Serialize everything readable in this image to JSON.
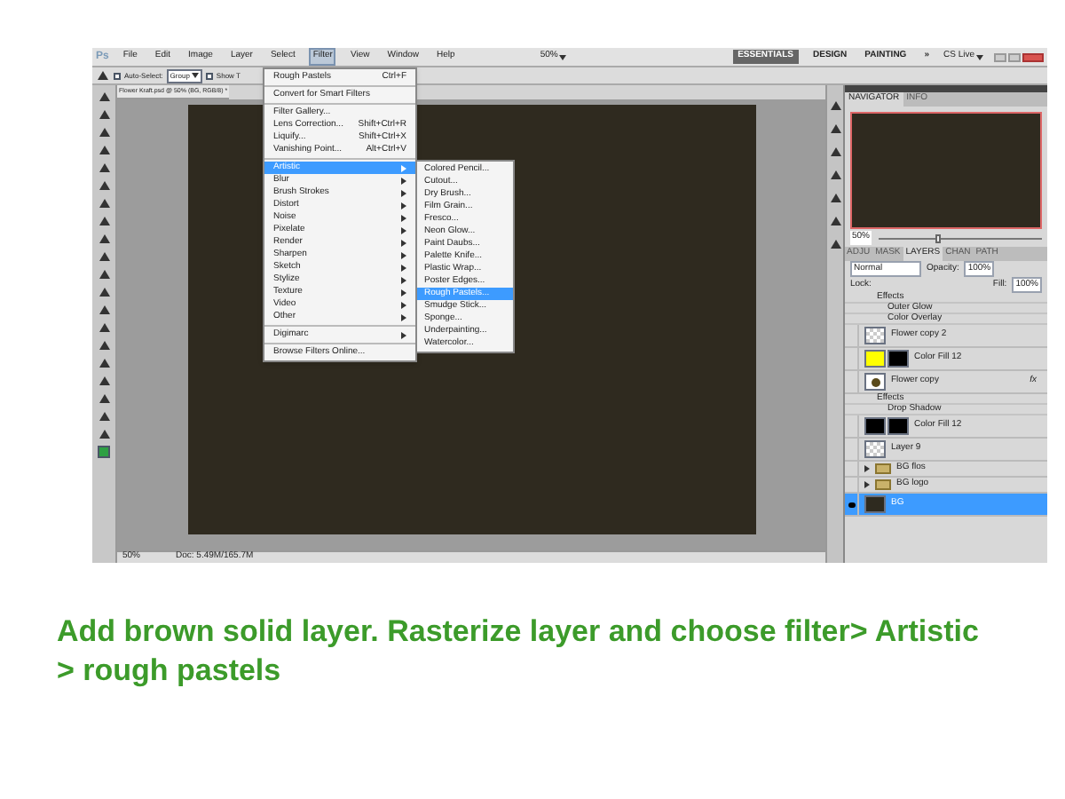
{
  "app_logo": "Ps",
  "menubar": [
    {
      "label": "File",
      "selected": false
    },
    {
      "label": "Edit",
      "selected": false
    },
    {
      "label": "Image",
      "selected": false
    },
    {
      "label": "Layer",
      "selected": false
    },
    {
      "label": "Select",
      "selected": false
    },
    {
      "label": "Filter",
      "selected": true
    },
    {
      "label": "View",
      "selected": false
    },
    {
      "label": "Window",
      "selected": false
    },
    {
      "label": "Help",
      "selected": false
    }
  ],
  "zoom": "50%",
  "workspaces": [
    {
      "label": "ESSENTIALS",
      "selected": true
    },
    {
      "label": "DESIGN",
      "selected": false
    },
    {
      "label": "PAINTING",
      "selected": false
    },
    {
      "label": "»",
      "selected": false
    }
  ],
  "cs_live": "CS Live",
  "options_bar": {
    "auto_select_checked": false,
    "auto_select_label": "Auto-Select:",
    "auto_select_value": "Group",
    "show_checked": false,
    "show_label": "Show T"
  },
  "document_tab": "Flower Kraft.psd @ 50% (BG, RGB/8) *",
  "filter_menu": [
    {
      "label": "Rough Pastels",
      "shortcut": "Ctrl+F",
      "submenu": false,
      "selected": false,
      "separator_after": true
    },
    {
      "label": "Convert for Smart Filters",
      "submenu": false,
      "selected": false,
      "separator_after": true
    },
    {
      "label": "Filter Gallery...",
      "submenu": false,
      "selected": false,
      "separator_after": false
    },
    {
      "label": "Lens Correction...",
      "shortcut": "Shift+Ctrl+R",
      "submenu": false,
      "selected": false,
      "separator_after": false
    },
    {
      "label": "Liquify...",
      "shortcut": "Shift+Ctrl+X",
      "submenu": false,
      "selected": false,
      "separator_after": false
    },
    {
      "label": "Vanishing Point...",
      "shortcut": "Alt+Ctrl+V",
      "submenu": false,
      "selected": false,
      "separator_after": true
    },
    {
      "label": "Artistic",
      "submenu": true,
      "selected": true,
      "separator_after": false
    },
    {
      "label": "Blur",
      "submenu": true,
      "selected": false,
      "separator_after": false
    },
    {
      "label": "Brush Strokes",
      "submenu": true,
      "selected": false,
      "separator_after": false
    },
    {
      "label": "Distort",
      "submenu": true,
      "selected": false,
      "separator_after": false
    },
    {
      "label": "Noise",
      "submenu": true,
      "selected": false,
      "separator_after": false
    },
    {
      "label": "Pixelate",
      "submenu": true,
      "selected": false,
      "separator_after": false
    },
    {
      "label": "Render",
      "submenu": true,
      "selected": false,
      "separator_after": false
    },
    {
      "label": "Sharpen",
      "submenu": true,
      "selected": false,
      "separator_after": false
    },
    {
      "label": "Sketch",
      "submenu": true,
      "selected": false,
      "separator_after": false
    },
    {
      "label": "Stylize",
      "submenu": true,
      "selected": false,
      "separator_after": false
    },
    {
      "label": "Texture",
      "submenu": true,
      "selected": false,
      "separator_after": false
    },
    {
      "label": "Video",
      "submenu": true,
      "selected": false,
      "separator_after": false
    },
    {
      "label": "Other",
      "submenu": true,
      "selected": false,
      "separator_after": true
    },
    {
      "label": "Digimarc",
      "submenu": true,
      "selected": false,
      "separator_after": true
    },
    {
      "label": "Browse Filters Online...",
      "submenu": false,
      "selected": false,
      "separator_after": false
    }
  ],
  "artistic_submenu": [
    {
      "label": "Colored Pencil...",
      "selected": false
    },
    {
      "label": "Cutout...",
      "selected": false
    },
    {
      "label": "Dry Brush...",
      "selected": false
    },
    {
      "label": "Film Grain...",
      "selected": false
    },
    {
      "label": "Fresco...",
      "selected": false
    },
    {
      "label": "Neon Glow...",
      "selected": false
    },
    {
      "label": "Paint Daubs...",
      "selected": false
    },
    {
      "label": "Palette Knife...",
      "selected": false
    },
    {
      "label": "Plastic Wrap...",
      "selected": false
    },
    {
      "label": "Poster Edges...",
      "selected": false
    },
    {
      "label": "Rough Pastels...",
      "selected": true
    },
    {
      "label": "Smudge Stick...",
      "selected": false
    },
    {
      "label": "Sponge...",
      "selected": false
    },
    {
      "label": "Underpainting...",
      "selected": false
    },
    {
      "label": "Watercolor...",
      "selected": false
    }
  ],
  "navigator": {
    "tabs": [
      {
        "label": "NAVIGATOR",
        "selected": true
      },
      {
        "label": "INFO",
        "selected": false
      }
    ],
    "zoom": "50%",
    "level": 0.35
  },
  "layers_panel": {
    "tabs": [
      {
        "label": "ADJU",
        "selected": false
      },
      {
        "label": "MASK",
        "selected": false
      },
      {
        "label": "LAYERS",
        "selected": true
      },
      {
        "label": "CHAN",
        "selected": false
      },
      {
        "label": "PATH",
        "selected": false
      }
    ],
    "blend_mode": "Normal",
    "opacity_label": "Opacity:",
    "opacity": "100%",
    "lock_label": "Lock:",
    "fill_label": "Fill:",
    "fill": "100%",
    "layers": [
      {
        "kind": "effects",
        "name": "Effects"
      },
      {
        "kind": "effect",
        "name": "Outer Glow"
      },
      {
        "kind": "effect",
        "name": "Color Overlay"
      },
      {
        "kind": "transparent-layer",
        "name": "Flower copy 2",
        "visible": false,
        "selected": false
      },
      {
        "kind": "fill",
        "color": "#ffff00",
        "name": "Color Fill 12",
        "visible": false,
        "selected": false
      },
      {
        "kind": "image-layer",
        "name": "Flower copy",
        "visible": false,
        "selected": false,
        "fx": "fx"
      },
      {
        "kind": "effects",
        "name": "Effects"
      },
      {
        "kind": "effect",
        "name": "Drop Shadow"
      },
      {
        "kind": "fill",
        "color": "#000000",
        "name": "Color Fill 12",
        "visible": false,
        "selected": false
      },
      {
        "kind": "transparent-layer",
        "name": "Layer 9",
        "visible": false,
        "selected": false
      },
      {
        "kind": "group",
        "name": "BG flos",
        "visible": false,
        "selected": false
      },
      {
        "kind": "group",
        "name": "BG logo",
        "visible": false,
        "selected": false
      },
      {
        "kind": "solid-layer",
        "name": "BG",
        "visible": true,
        "selected": true
      }
    ]
  },
  "status_bar": {
    "zoom": "50%",
    "doc": "Doc: 5.49M/165.7M"
  },
  "caption": "Add brown solid layer. Rasterize layer and choose filter> Artistic > rough pastels"
}
